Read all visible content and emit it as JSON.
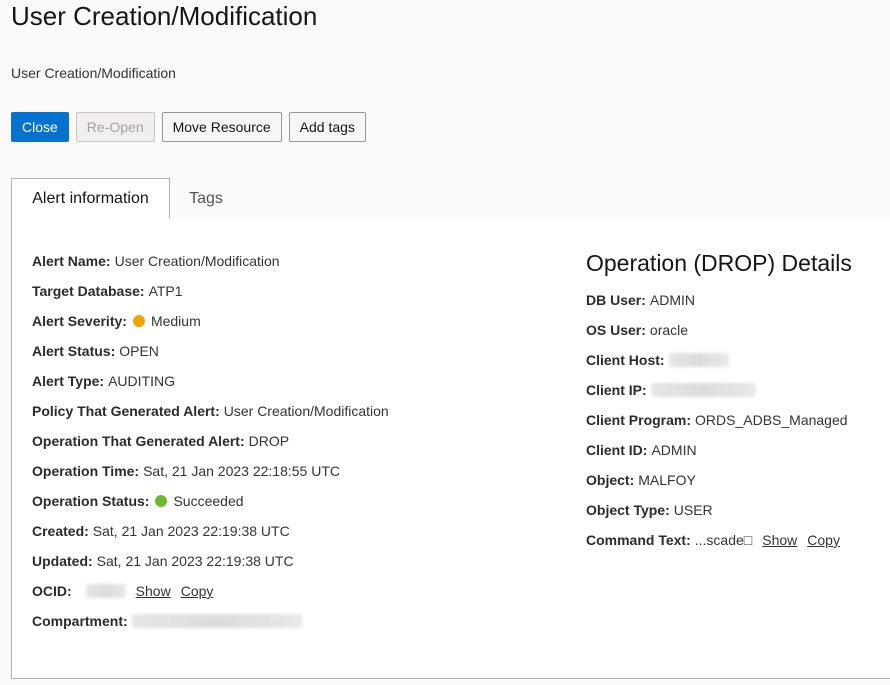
{
  "page": {
    "title": "User Creation/Modification",
    "subtitle": "User Creation/Modification"
  },
  "toolbar": {
    "close_label": "Close",
    "reopen_label": "Re-Open",
    "move_label": "Move Resource",
    "tags_label": "Add tags"
  },
  "tabs": [
    {
      "label": "Alert information",
      "active": true
    },
    {
      "label": "Tags",
      "active": false
    }
  ],
  "alert_info": {
    "alert_name": {
      "label": "Alert Name:",
      "value": "User Creation/Modification"
    },
    "target_db": {
      "label": "Target Database:",
      "value": "ATP1"
    },
    "severity": {
      "label": "Alert Severity:",
      "value": "Medium",
      "color": "#f0a500"
    },
    "status": {
      "label": "Alert Status:",
      "value": "OPEN"
    },
    "type": {
      "label": "Alert Type:",
      "value": "AUDITING"
    },
    "policy": {
      "label": "Policy That Generated Alert:",
      "value": "User Creation/Modification"
    },
    "operation": {
      "label": "Operation That Generated Alert:",
      "value": "DROP"
    },
    "op_time": {
      "label": "Operation Time:",
      "value": "Sat, 21 Jan 2023 22:18:55 UTC"
    },
    "op_status": {
      "label": "Operation Status:",
      "value": "Succeeded",
      "color": "#6eb92b"
    },
    "created": {
      "label": "Created:",
      "value": "Sat, 21 Jan 2023 22:19:38 UTC"
    },
    "updated": {
      "label": "Updated:",
      "value": "Sat, 21 Jan 2023 22:19:38 UTC"
    },
    "ocid": {
      "label": "OCID:",
      "show": "Show",
      "copy": "Copy"
    },
    "compartment": {
      "label": "Compartment:"
    }
  },
  "operation_details": {
    "title": "Operation (DROP) Details",
    "db_user": {
      "label": "DB User:",
      "value": "ADMIN"
    },
    "os_user": {
      "label": "OS User:",
      "value": "oracle"
    },
    "client_host": {
      "label": "Client Host:"
    },
    "client_ip": {
      "label": "Client IP:"
    },
    "client_program": {
      "label": "Client Program:",
      "value": "ORDS_ADBS_Managed"
    },
    "client_id": {
      "label": "Client ID:",
      "value": "ADMIN"
    },
    "object": {
      "label": "Object:",
      "value": "MALFOY"
    },
    "object_type": {
      "label": "Object Type:",
      "value": "USER"
    },
    "command_text": {
      "label": "Command Text:",
      "value": "...scade□",
      "show": "Show",
      "copy": "Copy"
    }
  },
  "colors": {
    "primary": "#0572ce",
    "severity_medium": "#f0a500",
    "status_succeeded": "#6eb92b"
  }
}
